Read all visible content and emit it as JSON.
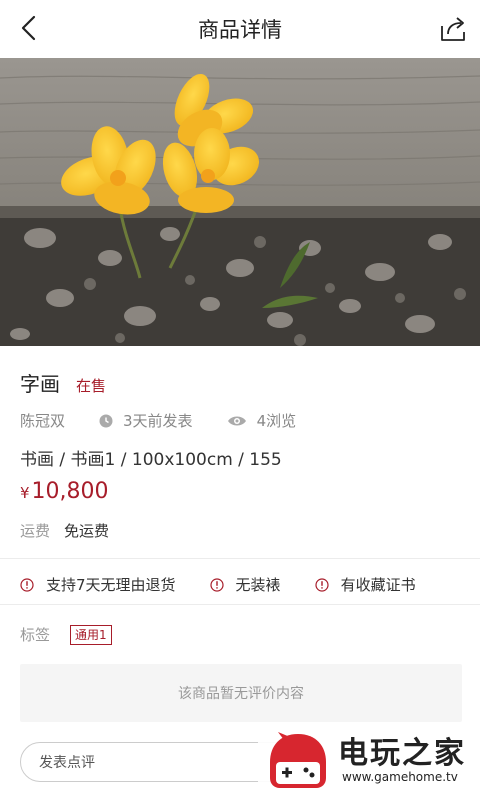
{
  "nav": {
    "title": "商品详情"
  },
  "item": {
    "name": "字画",
    "status": "在售",
    "seller": "陈冠双",
    "posted": "3天前发表",
    "views": "4浏览",
    "spec": "书画 / 书画1 / 100x100cm / 155",
    "currency": "¥",
    "price": "10,800",
    "shipping_label": "运费",
    "shipping_value": "免运费"
  },
  "guarantees": [
    {
      "label": "支持7天无理由退货",
      "icon": "info-circle-icon"
    },
    {
      "label": "无装裱",
      "icon": "info-circle-icon"
    },
    {
      "label": "有收藏证书",
      "icon": "info-circle-icon"
    }
  ],
  "tags": {
    "label": "标签",
    "items": [
      "通用1"
    ]
  },
  "reviews": {
    "empty_text": "该商品暂无评价内容"
  },
  "comment": {
    "placeholder": "发表点评"
  },
  "watermark": {
    "brand": "电玩之家",
    "url": "www.gamehome.tv"
  },
  "colors": {
    "accent": "#a71d2a",
    "text": "#333333",
    "muted": "#888888"
  }
}
